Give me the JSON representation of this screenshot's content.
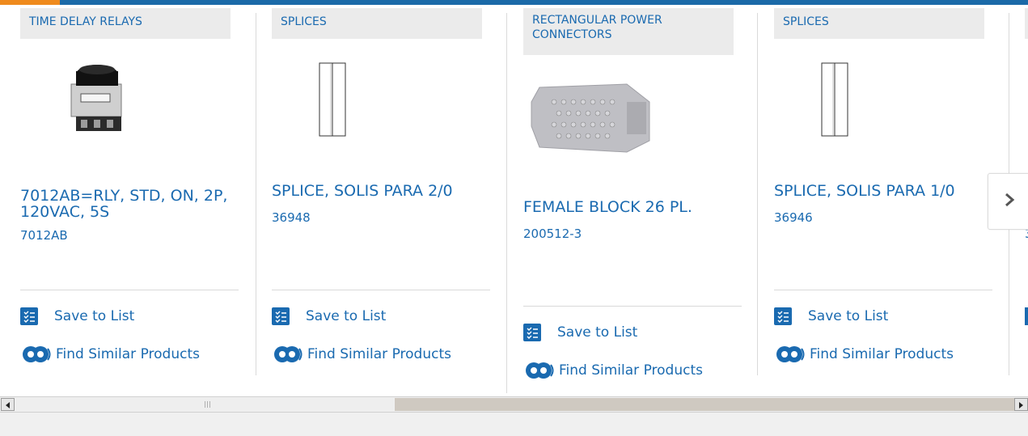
{
  "colors": {
    "link": "#1a6ab0",
    "brand_bar": "#1b6aa8",
    "accent": "#ef8a1d",
    "category_bg": "#ebebeb"
  },
  "cards": [
    {
      "category": "TIME DELAY RELAYS",
      "title": "7012AB=RLY, STD, ON, 2P, 120VAC, 5S",
      "part_number": "7012AB",
      "save_label": "Save to List",
      "similar_label": "Find Similar Products",
      "image": "time-delay-relay-image"
    },
    {
      "category": "SPLICES",
      "title": "SPLICE, SOLIS PARA 2/0",
      "part_number": "36948",
      "save_label": "Save to List",
      "similar_label": "Find Similar Products",
      "image": "splice-image"
    },
    {
      "category": "RECTANGULAR POWER CONNECTORS",
      "title": "FEMALE BLOCK 26 PL.",
      "part_number": "200512-3",
      "save_label": "Save to List",
      "similar_label": "Find Similar Products",
      "image": "power-connector-image"
    },
    {
      "category": "SPLICES",
      "title": "SPLICE, SOLIS PARA 1/0",
      "part_number": "36946",
      "save_label": "Save to List",
      "similar_label": "Find Similar Products",
      "image": "splice-image"
    }
  ],
  "partial_card": {
    "part_number_fragment": "3"
  },
  "carousel": {
    "next_icon": "chevron-right-icon"
  },
  "scrollbar": {
    "left_icon": "arrow-left-icon",
    "right_icon": "arrow-right-icon"
  }
}
